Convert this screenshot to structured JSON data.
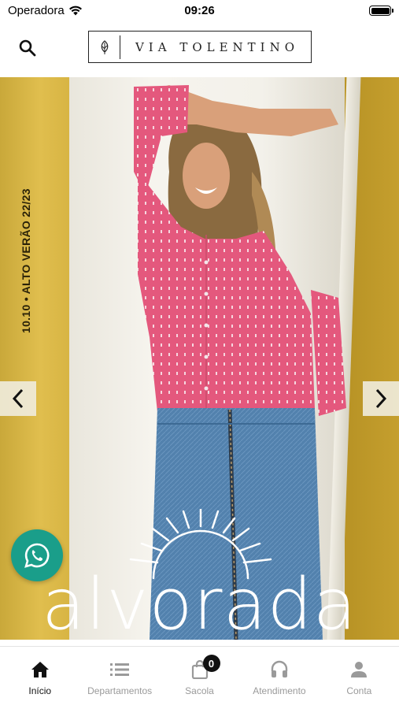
{
  "status_bar": {
    "carrier": "Operadora",
    "time": "09:26"
  },
  "header": {
    "logo_text": "VIA TOLENTINO",
    "search_icon": "search-icon"
  },
  "banner": {
    "season_text": "10.10 • ALTO VERÃO 22/23",
    "collection_text": "alvorada",
    "prev_icon": "chevron-left-icon",
    "next_icon": "chevron-right-icon"
  },
  "whatsapp": {
    "icon": "whatsapp-icon",
    "color": "#1a9e8a"
  },
  "tabs": [
    {
      "label": "Início",
      "icon": "home-icon",
      "active": true
    },
    {
      "label": "Departamentos",
      "icon": "list-icon",
      "active": false
    },
    {
      "label": "Sacola",
      "icon": "bag-icon",
      "active": false,
      "badge": "0"
    },
    {
      "label": "Atendimento",
      "icon": "headset-icon",
      "active": false
    },
    {
      "label": "Conta",
      "icon": "user-icon",
      "active": false
    }
  ],
  "colors": {
    "accent": "#111111",
    "inactive": "#9a9a9a",
    "banner_gold": "#c9a83a",
    "shirt_pink": "#e45a7f",
    "denim": "#4d79a6"
  }
}
